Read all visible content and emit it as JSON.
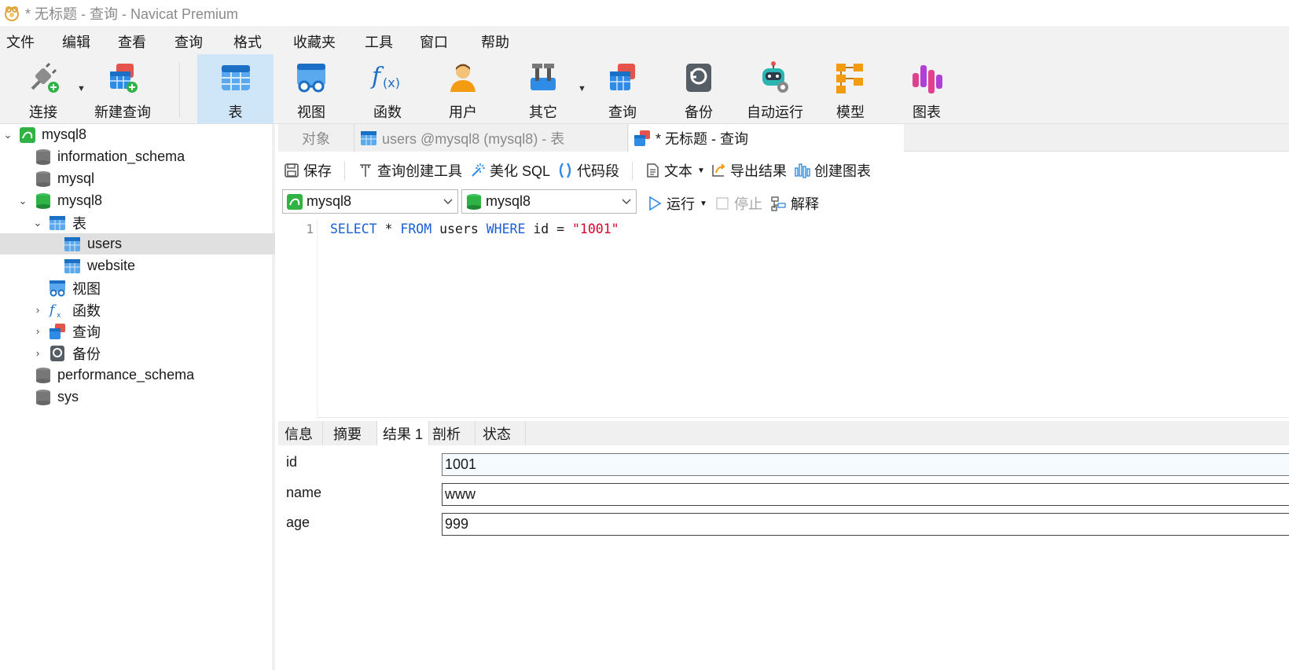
{
  "window": {
    "title": "* 无标题 - 查询 - Navicat Premium"
  },
  "menu": [
    "文件",
    "编辑",
    "查看",
    "查询",
    "格式",
    "收藏夹",
    "工具",
    "窗口",
    "帮助"
  ],
  "toolbar": {
    "connect": "连接",
    "new_query": "新建查询",
    "table": "表",
    "view": "视图",
    "function": "函数",
    "user": "用户",
    "other": "其它",
    "query": "查询",
    "backup": "备份",
    "automation": "自动运行",
    "model": "模型",
    "chart": "图表"
  },
  "tree": [
    {
      "label": "mysql8"
    },
    {
      "label": "information_schema"
    },
    {
      "label": "mysql"
    },
    {
      "label": "mysql8"
    },
    {
      "label": "表"
    },
    {
      "label": "users"
    },
    {
      "label": "website"
    },
    {
      "label": "视图"
    },
    {
      "label": "函数"
    },
    {
      "label": "查询"
    },
    {
      "label": "备份"
    },
    {
      "label": "performance_schema"
    },
    {
      "label": "sys"
    }
  ],
  "tabs": {
    "objects": "对象",
    "users_table": "users @mysql8 (mysql8) - 表",
    "query": "* 无标题 - 查询"
  },
  "query_toolbar": {
    "save": "保存",
    "query_builder": "查询创建工具",
    "beautify": "美化 SQL",
    "snippet": "代码段",
    "text": "文本",
    "export": "导出结果",
    "create_chart": "创建图表"
  },
  "connection_row": {
    "connection": "mysql8",
    "database": "mysql8",
    "run": "运行",
    "stop": "停止",
    "explain": "解释"
  },
  "editor": {
    "line_number": "1",
    "tokens": {
      "select": "SELECT",
      "star": " * ",
      "from": "FROM",
      "table": " users ",
      "where": "WHERE",
      "cond": " id = ",
      "value": "\"1001\""
    }
  },
  "result_tabs": [
    "信息",
    "摘要",
    "结果 1",
    "剖析",
    "状态"
  ],
  "record": [
    {
      "field": "id",
      "value": "1001"
    },
    {
      "field": "name",
      "value": "www"
    },
    {
      "field": "age",
      "value": "999"
    }
  ]
}
